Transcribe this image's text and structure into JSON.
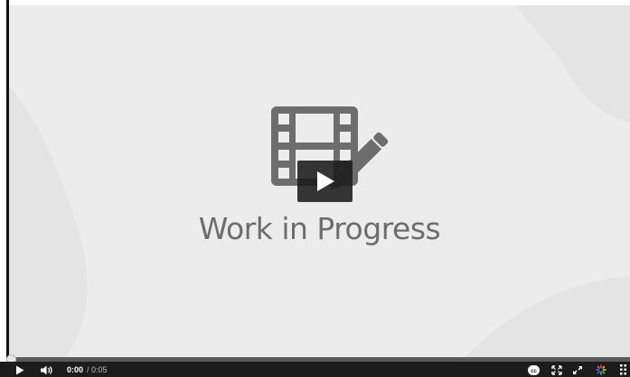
{
  "video": {
    "title_text": "Work in Progress",
    "progress_fraction": 0.0
  },
  "controls": {
    "current_time": "0:00",
    "separator": "/",
    "duration": "0:05",
    "icons": {
      "play": "play-icon",
      "volume": "volume-icon",
      "captions": "closed-captions-icon",
      "fullscreen": "fullscreen-icon",
      "popout": "popout-icon",
      "settings": "spinner-settings-icon",
      "more": "grid-menu-icon"
    }
  },
  "colors": {
    "stage_background": "#ececec",
    "icon_gray": "#6d6d6d",
    "control_bar": "#1c1c1c",
    "progress_track": "#5a5a5a",
    "text_white": "#ffffff"
  }
}
